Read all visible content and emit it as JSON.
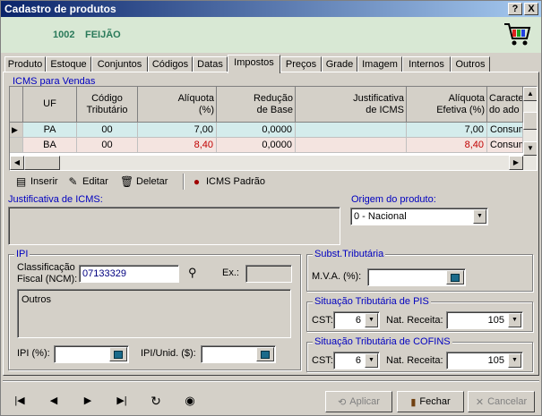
{
  "window": {
    "title": "Cadastro de produtos",
    "help_label": "?",
    "close_label": "X"
  },
  "product": {
    "code": "1002",
    "name": "FEIJÃO"
  },
  "tabs": [
    {
      "label": "Produto"
    },
    {
      "label": "Estoque"
    },
    {
      "label": "Conjuntos"
    },
    {
      "label": "Códigos"
    },
    {
      "label": "Datas"
    },
    {
      "label": "Impostos"
    },
    {
      "label": "Preços"
    },
    {
      "label": "Grade"
    },
    {
      "label": "Imagem"
    },
    {
      "label": "Internos"
    },
    {
      "label": "Outros"
    }
  ],
  "active_tab": "Impostos",
  "icms": {
    "title": "ICMS para Vendas",
    "columns": [
      "UF",
      "Código\nTributário",
      "Alíquota\n(%)",
      "Redução\nde Base",
      "Justificativa\nde ICMS",
      "Alíquota\nEfetiva (%)",
      "Caracte\ndo ado"
    ],
    "rows": [
      {
        "uf": "PA",
        "codigo": "00",
        "aliquota": "7,00",
        "reducao": "0,0000",
        "justificativa": "",
        "efetiva": "7,00",
        "caract": "Consum"
      },
      {
        "uf": "BA",
        "codigo": "00",
        "aliquota": "8,40",
        "reducao": "0,0000",
        "justificativa": "",
        "efetiva": "8,40",
        "caract": "Consum"
      }
    ],
    "row_colors": {
      "selected_bg": "#d4ecec",
      "red_text": "#c00000"
    }
  },
  "actions": {
    "inserir": "Inserir",
    "editar": "Editar",
    "deletar": "Deletar",
    "icms_padrao": "ICMS Padrão"
  },
  "justificativa": {
    "label": "Justificativa de ICMS:",
    "value": ""
  },
  "origem": {
    "label": "Origem do produto:",
    "value": "0 - Nacional"
  },
  "ipi": {
    "title": "IPI",
    "ncm_label": "Classificação\nFiscal (NCM):",
    "ncm_value": "07133329",
    "ex_label": "Ex.:",
    "ex_value": "",
    "description": "Outros",
    "ipi_pct_label": "IPI (%):",
    "ipi_pct_value": "",
    "ipi_unid_label": "IPI/Unid. ($):",
    "ipi_unid_value": ""
  },
  "subst": {
    "title": "Subst.Tributária",
    "mva_label": "M.V.A. (%):",
    "mva_value": ""
  },
  "pis": {
    "title": "Situação Tributária de PIS",
    "cst_label": "CST:",
    "cst_value": "6",
    "nat_label": "Nat. Receita:",
    "nat_value": "105"
  },
  "cofins": {
    "title": "Situação Tributária de COFINS",
    "cst_label": "CST:",
    "cst_value": "6",
    "nat_label": "Nat. Receita:",
    "nat_value": "105"
  },
  "footer": {
    "aplicar": "Aplicar",
    "fechar": "Fechar",
    "cancelar": "Cancelar"
  }
}
